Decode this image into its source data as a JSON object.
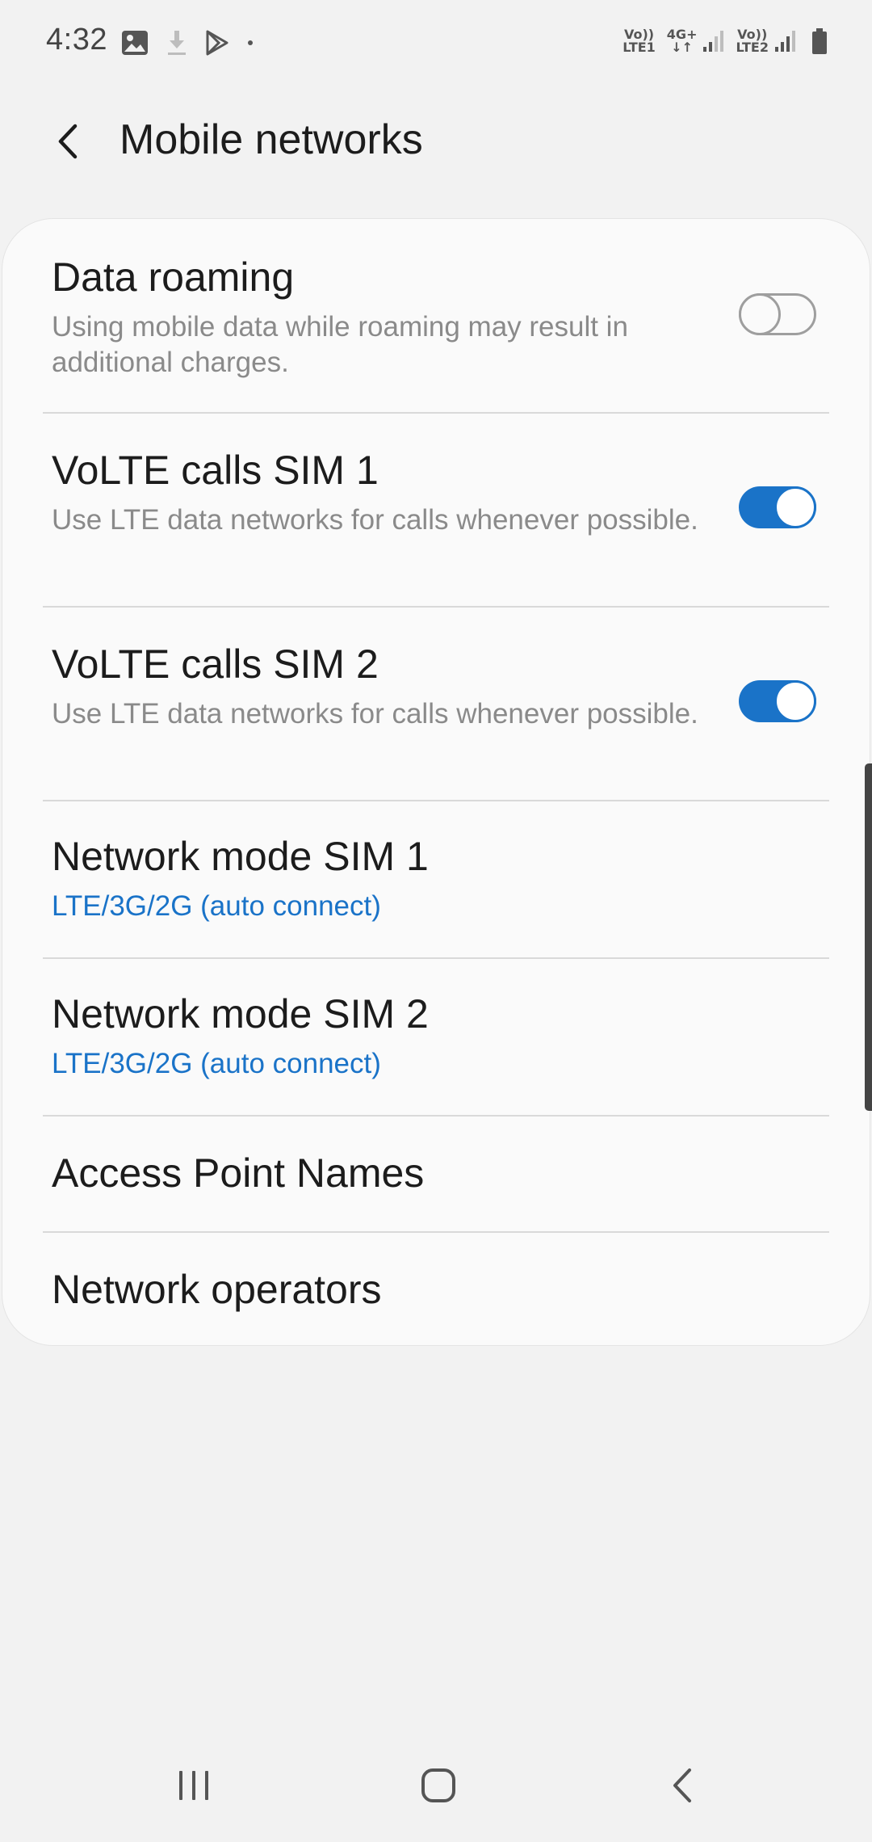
{
  "status_bar": {
    "time": "4:32",
    "left_icons": [
      "gallery-icon",
      "download-icon",
      "play-store-icon",
      "dot-icon"
    ],
    "sim1_label_top": "Vo))",
    "sim1_label_bottom": "LTE1",
    "data_label_top": "4G+",
    "data_label_bottom": "↓↑",
    "sim2_label_top": "Vo))",
    "sim2_label_bottom": "LTE2"
  },
  "header": {
    "title": "Mobile networks"
  },
  "settings": [
    {
      "title": "Data roaming",
      "subtitle": "Using mobile data while roaming may result in additional charges.",
      "toggle": "off"
    },
    {
      "title": "VoLTE calls SIM 1",
      "subtitle": "Use LTE data networks for calls whenever possible.",
      "toggle": "on"
    },
    {
      "title": "VoLTE calls SIM 2",
      "subtitle": "Use LTE data networks for calls whenever possible.",
      "toggle": "on"
    },
    {
      "title": "Network mode SIM 1",
      "value": "LTE/3G/2G (auto connect)"
    },
    {
      "title": "Network mode SIM 2",
      "value": "LTE/3G/2G (auto connect)"
    },
    {
      "title": "Access Point Names"
    },
    {
      "title": "Network operators"
    }
  ],
  "colors": {
    "accent": "#1a73c8",
    "background": "#f2f2f2",
    "card": "#fafafa",
    "subtitle": "#8a8a8a"
  },
  "nav_bar": {
    "buttons": [
      "recents-icon",
      "home-icon",
      "back-icon"
    ]
  }
}
